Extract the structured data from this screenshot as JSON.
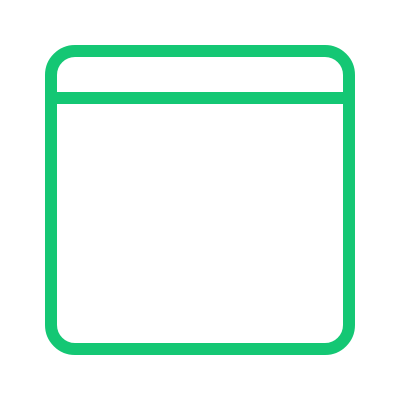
{
  "icon": {
    "name": "browser-window-icon",
    "stroke_color": "#14c774",
    "background_color": "#ffffff"
  }
}
